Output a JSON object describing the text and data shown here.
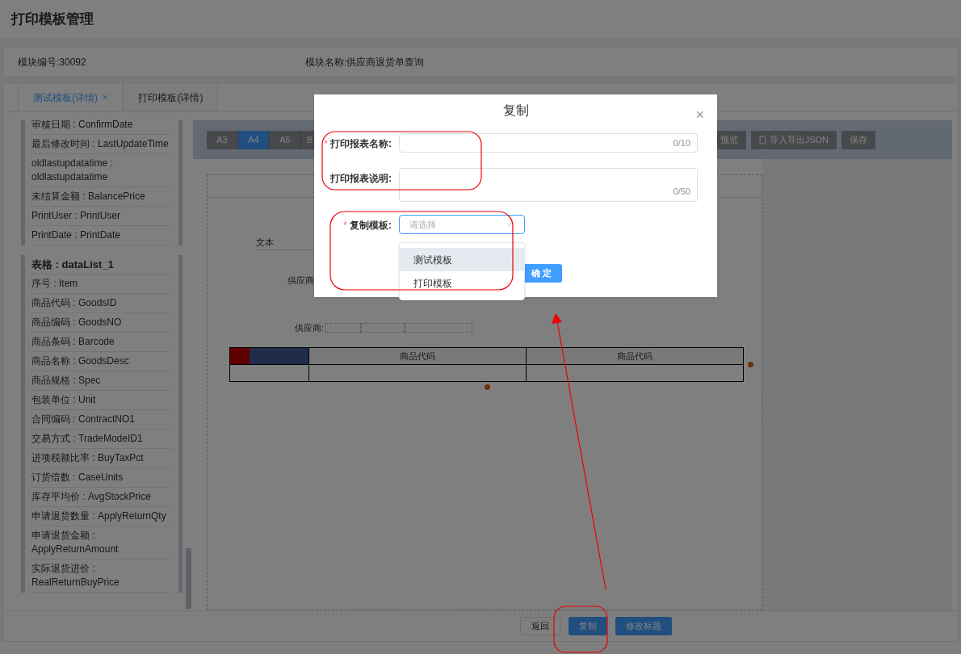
{
  "page_title": "打印模板管理",
  "module": {
    "code": "模块编号:30092",
    "name": "模块名称:供应商退货单查询"
  },
  "tabs": [
    {
      "label": "测试模板(详情)",
      "selected": true,
      "close": "×"
    },
    {
      "label": "打印模板(详情)",
      "selected": false
    }
  ],
  "field_groups": [
    {
      "items": [
        {
          "kind": "field",
          "text": "审核日期 : ConfirmDate"
        },
        {
          "kind": "field",
          "text": "最后修改时间 : LastUpdateTime"
        },
        {
          "kind": "field",
          "text": "oldlastupdatatime : oldlastupdatatime"
        },
        {
          "kind": "field",
          "text": "未结算金额 : BalancePrice"
        },
        {
          "kind": "field",
          "text": "PrintUser : PrintUser"
        },
        {
          "kind": "field",
          "text": "PrintDate : PrintDate"
        }
      ]
    },
    {
      "items": [
        {
          "kind": "heading",
          "text": "表格 : dataList_1"
        },
        {
          "kind": "field",
          "text": "序号 : Item"
        },
        {
          "kind": "field",
          "text": "商品代码 : GoodsID"
        },
        {
          "kind": "field",
          "text": "商品编码 : GoodsNO"
        },
        {
          "kind": "field",
          "text": "商品条码 : Barcode"
        },
        {
          "kind": "field",
          "text": "商品名称 : GoodsDesc"
        },
        {
          "kind": "field",
          "text": "商品规格 : Spec"
        },
        {
          "kind": "field",
          "text": "包装单位 : Unit"
        },
        {
          "kind": "field",
          "text": "合同编码 : ContractNO1"
        },
        {
          "kind": "field",
          "text": "交易方式 : TradeModeID1"
        },
        {
          "kind": "field",
          "text": "进项税额比率 : BuyTaxPct"
        },
        {
          "kind": "field",
          "text": "订货倍数 : CaseUnits"
        },
        {
          "kind": "field",
          "text": "库存平均价 : AvgStockPrice"
        },
        {
          "kind": "field",
          "text": "申请退货数量 : ApplyReturnQty"
        },
        {
          "kind": "field",
          "text": "申请退货金额 : ApplyReturnAmount"
        },
        {
          "kind": "field",
          "text": "实际退货进价 : RealReturnBuyPrice"
        }
      ]
    }
  ],
  "paper_sizes": [
    {
      "label": "A3",
      "selected": false
    },
    {
      "label": "A4",
      "selected": true
    },
    {
      "label": "A5",
      "selected": false
    },
    {
      "label": "B",
      "selected": false
    }
  ],
  "toolbar_actions": [
    "预览",
    "导入导出JSON",
    "保存"
  ],
  "canvas": {
    "text_label": "文本",
    "supplier_label": "供应商",
    "supplier_field": "供应商:",
    "table_headers": [
      "商品代码",
      "商品代码"
    ]
  },
  "footer_buttons": [
    {
      "label": "返回",
      "kind": "default"
    },
    {
      "label": "复制",
      "kind": "primary"
    },
    {
      "label": "修改标题",
      "kind": "primary"
    }
  ],
  "dialog": {
    "title": "复制",
    "close": "×",
    "fields": [
      {
        "kind": "input",
        "required_mark": "*",
        "label": "打印报表名称:",
        "counter": "0/10"
      },
      {
        "kind": "textarea",
        "label": "打印报表说明:",
        "counter": "0/50"
      },
      {
        "kind": "select",
        "required_mark": "*",
        "label": "复制模板:",
        "placeholder": "请选择"
      }
    ],
    "options": [
      {
        "label": "测试模板",
        "highlighted": true
      },
      {
        "label": "打印模板",
        "highlighted": false
      }
    ],
    "confirm": "确 定"
  }
}
